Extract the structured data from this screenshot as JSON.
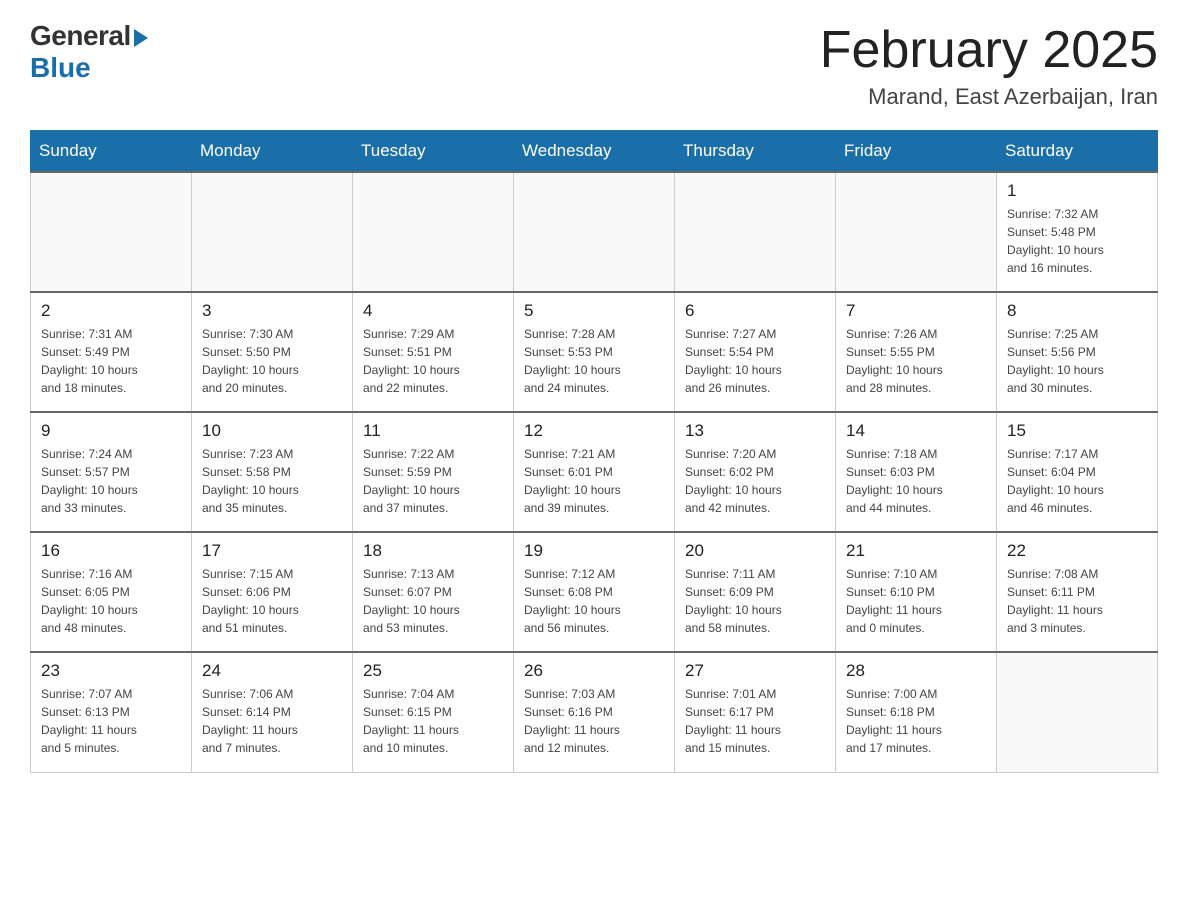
{
  "header": {
    "logo_general": "General",
    "logo_blue": "Blue",
    "month_title": "February 2025",
    "location": "Marand, East Azerbaijan, Iran"
  },
  "days_of_week": [
    "Sunday",
    "Monday",
    "Tuesday",
    "Wednesday",
    "Thursday",
    "Friday",
    "Saturday"
  ],
  "weeks": [
    {
      "days": [
        {
          "num": "",
          "info": ""
        },
        {
          "num": "",
          "info": ""
        },
        {
          "num": "",
          "info": ""
        },
        {
          "num": "",
          "info": ""
        },
        {
          "num": "",
          "info": ""
        },
        {
          "num": "",
          "info": ""
        },
        {
          "num": "1",
          "info": "Sunrise: 7:32 AM\nSunset: 5:48 PM\nDaylight: 10 hours\nand 16 minutes."
        }
      ]
    },
    {
      "days": [
        {
          "num": "2",
          "info": "Sunrise: 7:31 AM\nSunset: 5:49 PM\nDaylight: 10 hours\nand 18 minutes."
        },
        {
          "num": "3",
          "info": "Sunrise: 7:30 AM\nSunset: 5:50 PM\nDaylight: 10 hours\nand 20 minutes."
        },
        {
          "num": "4",
          "info": "Sunrise: 7:29 AM\nSunset: 5:51 PM\nDaylight: 10 hours\nand 22 minutes."
        },
        {
          "num": "5",
          "info": "Sunrise: 7:28 AM\nSunset: 5:53 PM\nDaylight: 10 hours\nand 24 minutes."
        },
        {
          "num": "6",
          "info": "Sunrise: 7:27 AM\nSunset: 5:54 PM\nDaylight: 10 hours\nand 26 minutes."
        },
        {
          "num": "7",
          "info": "Sunrise: 7:26 AM\nSunset: 5:55 PM\nDaylight: 10 hours\nand 28 minutes."
        },
        {
          "num": "8",
          "info": "Sunrise: 7:25 AM\nSunset: 5:56 PM\nDaylight: 10 hours\nand 30 minutes."
        }
      ]
    },
    {
      "days": [
        {
          "num": "9",
          "info": "Sunrise: 7:24 AM\nSunset: 5:57 PM\nDaylight: 10 hours\nand 33 minutes."
        },
        {
          "num": "10",
          "info": "Sunrise: 7:23 AM\nSunset: 5:58 PM\nDaylight: 10 hours\nand 35 minutes."
        },
        {
          "num": "11",
          "info": "Sunrise: 7:22 AM\nSunset: 5:59 PM\nDaylight: 10 hours\nand 37 minutes."
        },
        {
          "num": "12",
          "info": "Sunrise: 7:21 AM\nSunset: 6:01 PM\nDaylight: 10 hours\nand 39 minutes."
        },
        {
          "num": "13",
          "info": "Sunrise: 7:20 AM\nSunset: 6:02 PM\nDaylight: 10 hours\nand 42 minutes."
        },
        {
          "num": "14",
          "info": "Sunrise: 7:18 AM\nSunset: 6:03 PM\nDaylight: 10 hours\nand 44 minutes."
        },
        {
          "num": "15",
          "info": "Sunrise: 7:17 AM\nSunset: 6:04 PM\nDaylight: 10 hours\nand 46 minutes."
        }
      ]
    },
    {
      "days": [
        {
          "num": "16",
          "info": "Sunrise: 7:16 AM\nSunset: 6:05 PM\nDaylight: 10 hours\nand 48 minutes."
        },
        {
          "num": "17",
          "info": "Sunrise: 7:15 AM\nSunset: 6:06 PM\nDaylight: 10 hours\nand 51 minutes."
        },
        {
          "num": "18",
          "info": "Sunrise: 7:13 AM\nSunset: 6:07 PM\nDaylight: 10 hours\nand 53 minutes."
        },
        {
          "num": "19",
          "info": "Sunrise: 7:12 AM\nSunset: 6:08 PM\nDaylight: 10 hours\nand 56 minutes."
        },
        {
          "num": "20",
          "info": "Sunrise: 7:11 AM\nSunset: 6:09 PM\nDaylight: 10 hours\nand 58 minutes."
        },
        {
          "num": "21",
          "info": "Sunrise: 7:10 AM\nSunset: 6:10 PM\nDaylight: 11 hours\nand 0 minutes."
        },
        {
          "num": "22",
          "info": "Sunrise: 7:08 AM\nSunset: 6:11 PM\nDaylight: 11 hours\nand 3 minutes."
        }
      ]
    },
    {
      "days": [
        {
          "num": "23",
          "info": "Sunrise: 7:07 AM\nSunset: 6:13 PM\nDaylight: 11 hours\nand 5 minutes."
        },
        {
          "num": "24",
          "info": "Sunrise: 7:06 AM\nSunset: 6:14 PM\nDaylight: 11 hours\nand 7 minutes."
        },
        {
          "num": "25",
          "info": "Sunrise: 7:04 AM\nSunset: 6:15 PM\nDaylight: 11 hours\nand 10 minutes."
        },
        {
          "num": "26",
          "info": "Sunrise: 7:03 AM\nSunset: 6:16 PM\nDaylight: 11 hours\nand 12 minutes."
        },
        {
          "num": "27",
          "info": "Sunrise: 7:01 AM\nSunset: 6:17 PM\nDaylight: 11 hours\nand 15 minutes."
        },
        {
          "num": "28",
          "info": "Sunrise: 7:00 AM\nSunset: 6:18 PM\nDaylight: 11 hours\nand 17 minutes."
        },
        {
          "num": "",
          "info": ""
        }
      ]
    }
  ]
}
